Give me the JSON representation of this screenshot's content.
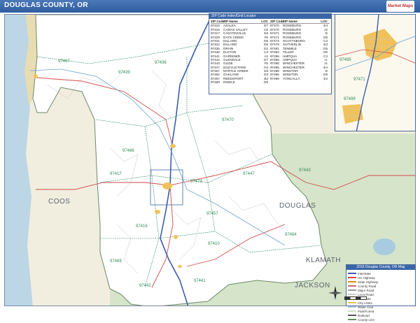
{
  "header": {
    "title": "DOUGLAS COUNTY, OR",
    "logo_text": "Market Maps"
  },
  "map": {
    "county_labels": [
      "COOS",
      "DOUGLAS",
      "KLAMATH",
      "JACKSON"
    ],
    "zip_labels": [
      "97467",
      "97439",
      "97436",
      "97470",
      "97486",
      "97417",
      "97447",
      "97473",
      "97443",
      "97457",
      "97416",
      "97484",
      "97469",
      "97410",
      "97442",
      "97441",
      "97495",
      "97499",
      "97471"
    ],
    "colors": {
      "county_fill": "#ffffff",
      "neighbor_fill": "#efeadb",
      "forest_fill": "#cfe0c4",
      "ocean_fill": "#bcd6e6",
      "urban_fill": "#f1c25a",
      "highway": "#3b5ea8",
      "road": "#d24a4a",
      "zip_boundary": "#2c8a5a"
    }
  },
  "zip_index": {
    "title": "ZIP Code Index/Grid Locator",
    "col_headers": [
      "ZIP Code",
      "ZIP Name",
      "LOC"
    ],
    "left": [
      [
        "97410",
        "AZALEA",
        "E7"
      ],
      [
        "97416",
        "CAMAS VALLEY",
        "C6"
      ],
      [
        "97417",
        "CANYONVILLE",
        "E6"
      ],
      [
        "97429",
        "DAYS CREEK",
        "F6"
      ],
      [
        "97431",
        "DILLARD",
        "D5"
      ],
      [
        "97432",
        "DILLARD",
        "D5"
      ],
      [
        "97435",
        "DRAIN",
        "D2"
      ],
      [
        "97436",
        "ELKTON",
        "C3"
      ],
      [
        "97441",
        "GARDINER",
        "A1"
      ],
      [
        "97442",
        "GLENDALE",
        "D7"
      ],
      [
        "97443",
        "GLIDE",
        "F5"
      ],
      [
        "97447",
        "IDLEYLD PARK",
        "H4"
      ],
      [
        "97457",
        "MYRTLE CREEK",
        "E6"
      ],
      [
        "97462",
        "OAKLAND",
        "D3"
      ],
      [
        "97467",
        "REEDSPORT",
        "B2"
      ],
      [
        "97469",
        "RIDDLE",
        "D6"
      ]
    ],
    "right": [
      [
        "97470",
        "ROSEBURG",
        "E4"
      ],
      [
        "97470",
        "ROSEBURG",
        "J2"
      ],
      [
        "97471",
        "ROSEBURG",
        "D"
      ],
      [
        "97471",
        "ROSEBURG",
        "D5"
      ],
      [
        "97473",
        "SCOTTSBURG",
        "C2"
      ],
      [
        "97479",
        "SUTHERLIN",
        "E3"
      ],
      [
        "97481",
        "TENMILE",
        "D5"
      ],
      [
        "97484",
        "TILLER",
        "G6"
      ],
      [
        "97486",
        "UMPQUA",
        "C4"
      ],
      [
        "97486",
        "UMPQUA",
        "I1"
      ],
      [
        "97495",
        "WINCHESTER",
        "J1"
      ],
      [
        "97495",
        "WINCHESTER",
        "E4"
      ],
      [
        "97496",
        "WINSTON",
        "D"
      ],
      [
        "97496",
        "WINSTON",
        "D6"
      ],
      [
        "97499",
        "YONCALLA",
        "E2"
      ]
    ]
  },
  "legend": {
    "title": "2016 Douglas County, OR Map",
    "items": [
      "Interstate",
      "US Highway",
      "State Highway",
      "County Road",
      "Major Road",
      "Local Road",
      "ZIP Code",
      "City Limits",
      "Water Area",
      "Park/Forest",
      "Railroad",
      "County Line"
    ]
  }
}
